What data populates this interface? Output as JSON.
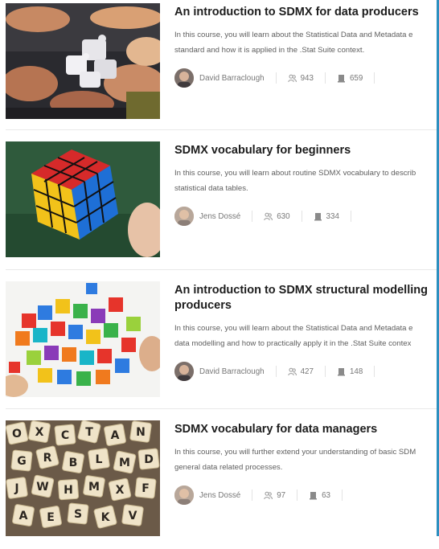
{
  "courses": [
    {
      "title": "An introduction to SDMX for data producers",
      "desc_line1": "In this course, you will learn about the Statistical Data and Metadata e",
      "desc_line2": "standard and how it is applied in the .Stat Suite context.",
      "author": "David Barraclough",
      "learners": "943",
      "lessons": "659",
      "image_icon": "puzzle-hands-image"
    },
    {
      "title": "SDMX vocabulary for beginners",
      "desc_line1": "In this course, you will learn about routine SDMX vocabulary to describ",
      "desc_line2": "statistical data tables.",
      "author": "Jens Dossé",
      "learners": "630",
      "lessons": "334",
      "image_icon": "rubiks-cube-image"
    },
    {
      "title_line1": "An introduction to SDMX structural modelling",
      "title_line2": "producers",
      "desc_line1": "In this course, you will learn about the Statistical Data and Metadata e",
      "desc_line2": "data modelling and how to practically apply it in the .Stat Suite contex",
      "author": "David Barraclough",
      "learners": "427",
      "lessons": "148",
      "image_icon": "colored-cubes-image"
    },
    {
      "title": "SDMX vocabulary for data managers",
      "desc_line1": "In this course, you will further extend your understanding of basic SDM",
      "desc_line2": "general data related processes.",
      "author": "Jens Dossé",
      "learners": "97",
      "lessons": "63",
      "image_icon": "letter-tiles-image"
    }
  ],
  "colors": {
    "accent_edge": "#2d8fbf",
    "title": "#1d1d1d",
    "meta": "#777777"
  }
}
